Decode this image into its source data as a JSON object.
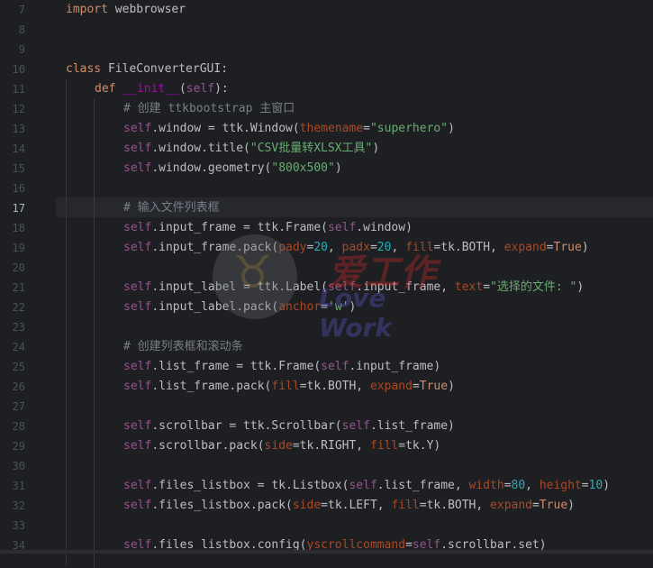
{
  "editor": {
    "current_line": "17",
    "lines": [
      {
        "num": "7"
      },
      {
        "num": "8"
      },
      {
        "num": "9"
      },
      {
        "num": "10"
      },
      {
        "num": "11"
      },
      {
        "num": "12"
      },
      {
        "num": "13"
      },
      {
        "num": "14"
      },
      {
        "num": "15"
      },
      {
        "num": "16"
      },
      {
        "num": "17"
      },
      {
        "num": "18"
      },
      {
        "num": "19"
      },
      {
        "num": "20"
      },
      {
        "num": "21"
      },
      {
        "num": "22"
      },
      {
        "num": "23"
      },
      {
        "num": "24"
      },
      {
        "num": "25"
      },
      {
        "num": "26"
      },
      {
        "num": "27"
      },
      {
        "num": "28"
      },
      {
        "num": "29"
      },
      {
        "num": "30"
      },
      {
        "num": "31"
      },
      {
        "num": "32"
      },
      {
        "num": "33"
      },
      {
        "num": "34"
      }
    ],
    "tokens": {
      "l7": [
        "import",
        " webbrowser"
      ],
      "l10": [
        "class",
        " FileConverterGUI:"
      ],
      "l11": [
        "def",
        " ",
        "__init__",
        "(",
        "self",
        "):"
      ],
      "l12": [
        "# 创建 ttkbootstrap 主窗口"
      ],
      "l13": [
        "self",
        ".window = ttk.Window(",
        "themename",
        "=",
        "\"superhero\"",
        ")"
      ],
      "l14": [
        "self",
        ".window.title(",
        "\"CSV批量转XLSX工具\"",
        ")"
      ],
      "l15": [
        "self",
        ".window.geometry(",
        "\"800x500\"",
        ")"
      ],
      "l17": [
        "# 输入文件列表框"
      ],
      "l18": [
        "self",
        ".input_frame = ttk.Frame(",
        "self",
        ".window)"
      ],
      "l19": [
        "self",
        ".input_frame.pack(",
        "pady",
        "=",
        "20",
        ", ",
        "padx",
        "=",
        "20",
        ", ",
        "fill",
        "=tk.BOTH, ",
        "expand",
        "=",
        "True",
        ")"
      ],
      "l21": [
        "self",
        ".input_label = ttk.Label(",
        "self",
        ".input_frame, ",
        "text",
        "=",
        "\"选择的文件: \"",
        ")"
      ],
      "l22": [
        "self",
        ".input_label.pack(",
        "anchor",
        "=",
        "'w'",
        ")"
      ],
      "l24": [
        "# 创建列表框和滚动条"
      ],
      "l25": [
        "self",
        ".list_frame = ttk.Frame(",
        "self",
        ".input_frame)"
      ],
      "l26": [
        "self",
        ".list_frame.pack(",
        "fill",
        "=tk.BOTH, ",
        "expand",
        "=",
        "True",
        ")"
      ],
      "l28": [
        "self",
        ".scrollbar = ttk.Scrollbar(",
        "self",
        ".list_frame)"
      ],
      "l29": [
        "self",
        ".scrollbar.pack(",
        "side",
        "=tk.RIGHT, ",
        "fill",
        "=tk.Y)"
      ],
      "l31": [
        "self",
        ".files_listbox = tk.Listbox(",
        "self",
        ".list_frame, ",
        "width",
        "=",
        "80",
        ", ",
        "height",
        "=",
        "10",
        ")"
      ],
      "l32": [
        "self",
        ".files_listbox.pack(",
        "side",
        "=tk.LEFT, ",
        "fill",
        "=tk.BOTH, ",
        "expand",
        "=",
        "True",
        ")"
      ],
      "l34": [
        "self",
        ".files_listbox.config(",
        "yscrollcommand",
        "=",
        "self",
        ".scrollbar.set)"
      ]
    }
  },
  "watermark": {
    "text_cn": "爱工作",
    "text_en": "Love Work",
    "logo_icon": "cow-mascot"
  }
}
